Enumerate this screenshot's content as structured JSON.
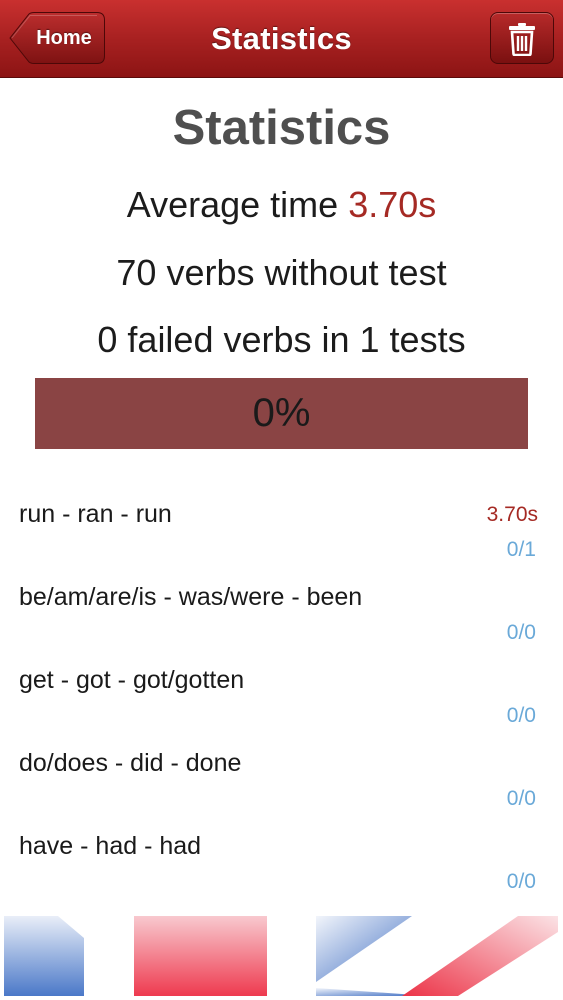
{
  "navbar": {
    "title": "Statistics",
    "back_label": "Home"
  },
  "icons": {
    "back": "back-chevron-icon",
    "trash": "trash-icon"
  },
  "colors": {
    "nav_red": "#a82121",
    "accent_red": "#a52a24",
    "progress_bg": "#8a4444",
    "score_blue": "#6aa9d8"
  },
  "stats": {
    "heading": "Statistics",
    "average_label": "Average time ",
    "average_value": "3.70s",
    "untested": "70 verbs without test",
    "failed": "0 failed verbs in 1 tests",
    "progress_label": "0%",
    "progress_percent": 0
  },
  "verbs": [
    {
      "name": "run - ran - run",
      "time": "3.70s",
      "score": "0/1"
    },
    {
      "name": "be/am/are/is - was/were - been",
      "time": "",
      "score": "0/0"
    },
    {
      "name": "get - got - got/gotten",
      "time": "",
      "score": "0/0"
    },
    {
      "name": "do/does - did - done",
      "time": "",
      "score": "0/0"
    },
    {
      "name": "have - had - had",
      "time": "",
      "score": "0/0"
    }
  ]
}
